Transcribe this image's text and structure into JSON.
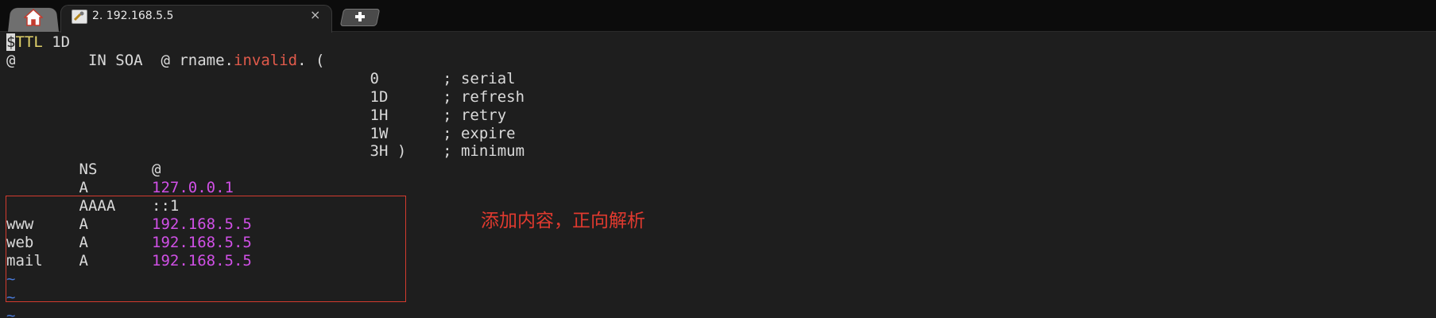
{
  "tabbar": {
    "home_icon": "home-icon",
    "active_tab": {
      "icon": "terminal-icon",
      "label": "2. 192.168.5.5",
      "close_glyph": "×"
    },
    "new_tab_icon": "plus-icon"
  },
  "zone_file": {
    "ttl_line": {
      "cursor_char": "$",
      "keyword": "TTL",
      "value": " 1D"
    },
    "soa_line": {
      "origin": "@",
      "record": "        IN SOA  @ rname.",
      "invalid": "invalid",
      "tail": ". ("
    },
    "serial_line": "                                        0       ; serial",
    "refresh_line": "                                        1D      ; refresh",
    "retry_line": "                                        1H      ; retry",
    "expire_line": "                                        1W      ; expire",
    "minimum_line": "                                        3H )    ; minimum",
    "ns_line": "        NS      @",
    "a_line": {
      "prefix": "        A       ",
      "value": "127.0.0.1"
    },
    "aaaa_line": "        AAAA    ::1",
    "www_line": {
      "prefix": "www     A       ",
      "value": "192.168.5.5"
    },
    "web_line": {
      "prefix": "web     A       ",
      "value": "192.168.5.5"
    },
    "mail_line": {
      "prefix": "mail    A       ",
      "value": "192.168.5.5"
    },
    "empty_line_marker": "~"
  },
  "annotation": {
    "text": "添加内容，正向解析",
    "color": "#e03a2f"
  },
  "colors": {
    "background": "#1e1e1e",
    "keyword": "#e2d36b",
    "highlight_red": "#e05a4b",
    "ip_magenta": "#d050e6",
    "tilde_blue": "#4a7ad7"
  }
}
